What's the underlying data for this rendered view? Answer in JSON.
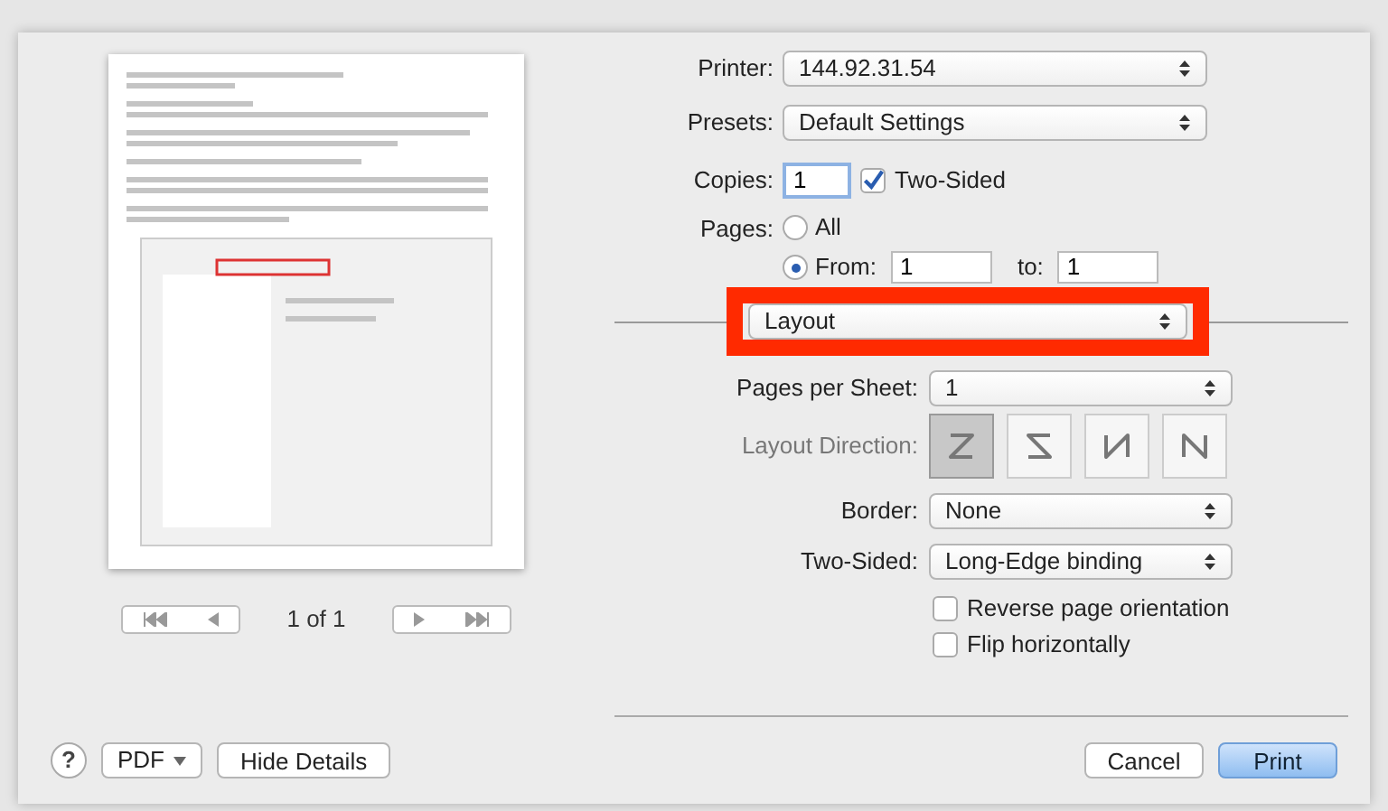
{
  "preview": {
    "page_counter": "1 of 1"
  },
  "printer": {
    "label": "Printer:",
    "value": "144.92.31.54"
  },
  "presets": {
    "label": "Presets:",
    "value": "Default Settings"
  },
  "copies": {
    "label": "Copies:",
    "value": "1"
  },
  "two_sided_checkbox": {
    "label": "Two-Sided",
    "checked": true
  },
  "pages": {
    "label": "Pages:",
    "options": [
      {
        "label": "All",
        "selected": false
      },
      {
        "label": "From:",
        "selected": true
      }
    ],
    "from": "1",
    "to_label": "to:",
    "to": "1"
  },
  "section_popup": {
    "value": "Layout",
    "highlighted": true
  },
  "pages_per_sheet": {
    "label": "Pages per Sheet:",
    "value": "1"
  },
  "layout_direction": {
    "label": "Layout Direction:",
    "options": [
      {
        "kind": "z",
        "selected": true
      },
      {
        "kind": "s",
        "selected": false
      },
      {
        "kind": "mirrored-n",
        "selected": false
      },
      {
        "kind": "n",
        "selected": false
      }
    ]
  },
  "border": {
    "label": "Border:",
    "value": "None"
  },
  "two_sided": {
    "label": "Two-Sided:",
    "value": "Long-Edge binding"
  },
  "options": [
    {
      "label": "Reverse page orientation",
      "checked": false
    },
    {
      "label": "Flip horizontally",
      "checked": false
    }
  ],
  "footer": {
    "help": "?",
    "pdf": "PDF",
    "hide_details": "Hide Details",
    "cancel": "Cancel",
    "print": "Print"
  }
}
